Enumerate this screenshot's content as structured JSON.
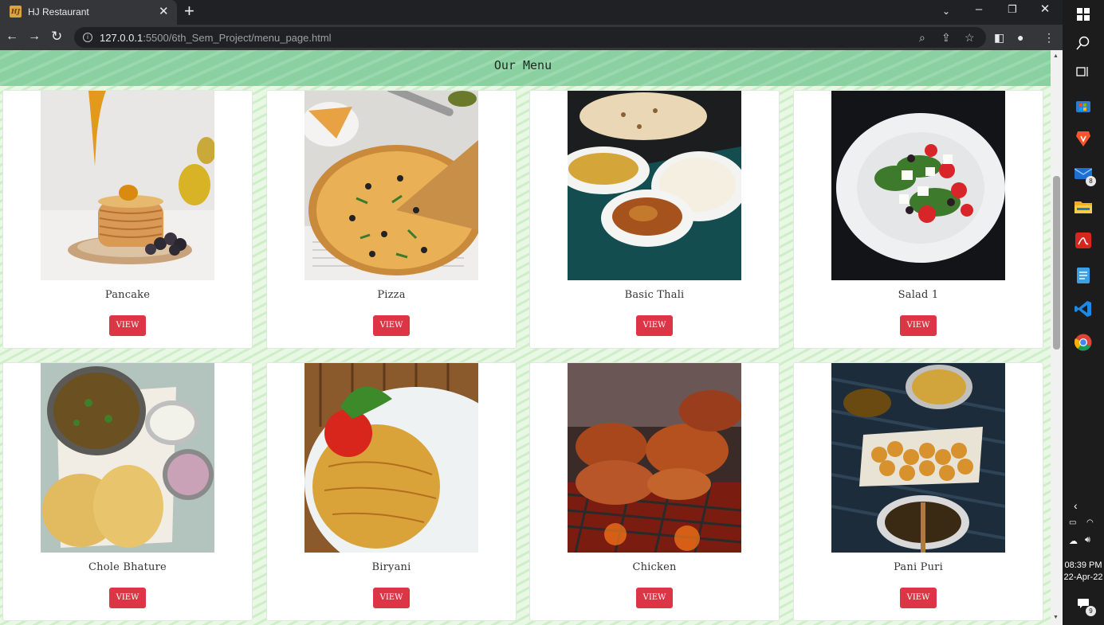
{
  "browser": {
    "tab_title": "HJ Restaurant",
    "favicon_text": "HJ",
    "new_tab_glyph": "+",
    "url_host": "127.0.0.1",
    "url_rest": ":5500/6th_Sem_Project/menu_page.html",
    "window_controls": [
      "chevron-down-icon",
      "minimize-icon",
      "restore-icon",
      "close-icon"
    ]
  },
  "page": {
    "heading": "Our Menu",
    "button_label": "VIEW",
    "items": [
      {
        "name": "Pancake",
        "photo": "pancake-photo"
      },
      {
        "name": "Pizza",
        "photo": "pizza-photo"
      },
      {
        "name": "Basic Thali",
        "photo": "thali-photo"
      },
      {
        "name": "Salad 1",
        "photo": "salad-photo"
      },
      {
        "name": "Chole Bhature",
        "photo": "chole-bhature-photo"
      },
      {
        "name": "Biryani",
        "photo": "biryani-photo"
      },
      {
        "name": "Chicken",
        "photo": "chicken-photo"
      },
      {
        "name": "Pani Puri",
        "photo": "pani-puri-photo"
      }
    ]
  },
  "colors": {
    "button": "#dc3545",
    "header_band": "#8bd0a0",
    "background_stripe": "#cdeec7"
  },
  "taskbar": {
    "apps": [
      "windows-start-icon",
      "search-icon",
      "task-view-icon",
      "store-icon",
      "brave-icon",
      "mail-icon",
      "file-explorer-icon",
      "acrobat-icon",
      "notepad-icon",
      "vscode-icon",
      "chrome-icon"
    ],
    "mail_badge": "8",
    "notification_badge": "9",
    "time": "08:39 PM",
    "date": "22-Apr-22"
  }
}
